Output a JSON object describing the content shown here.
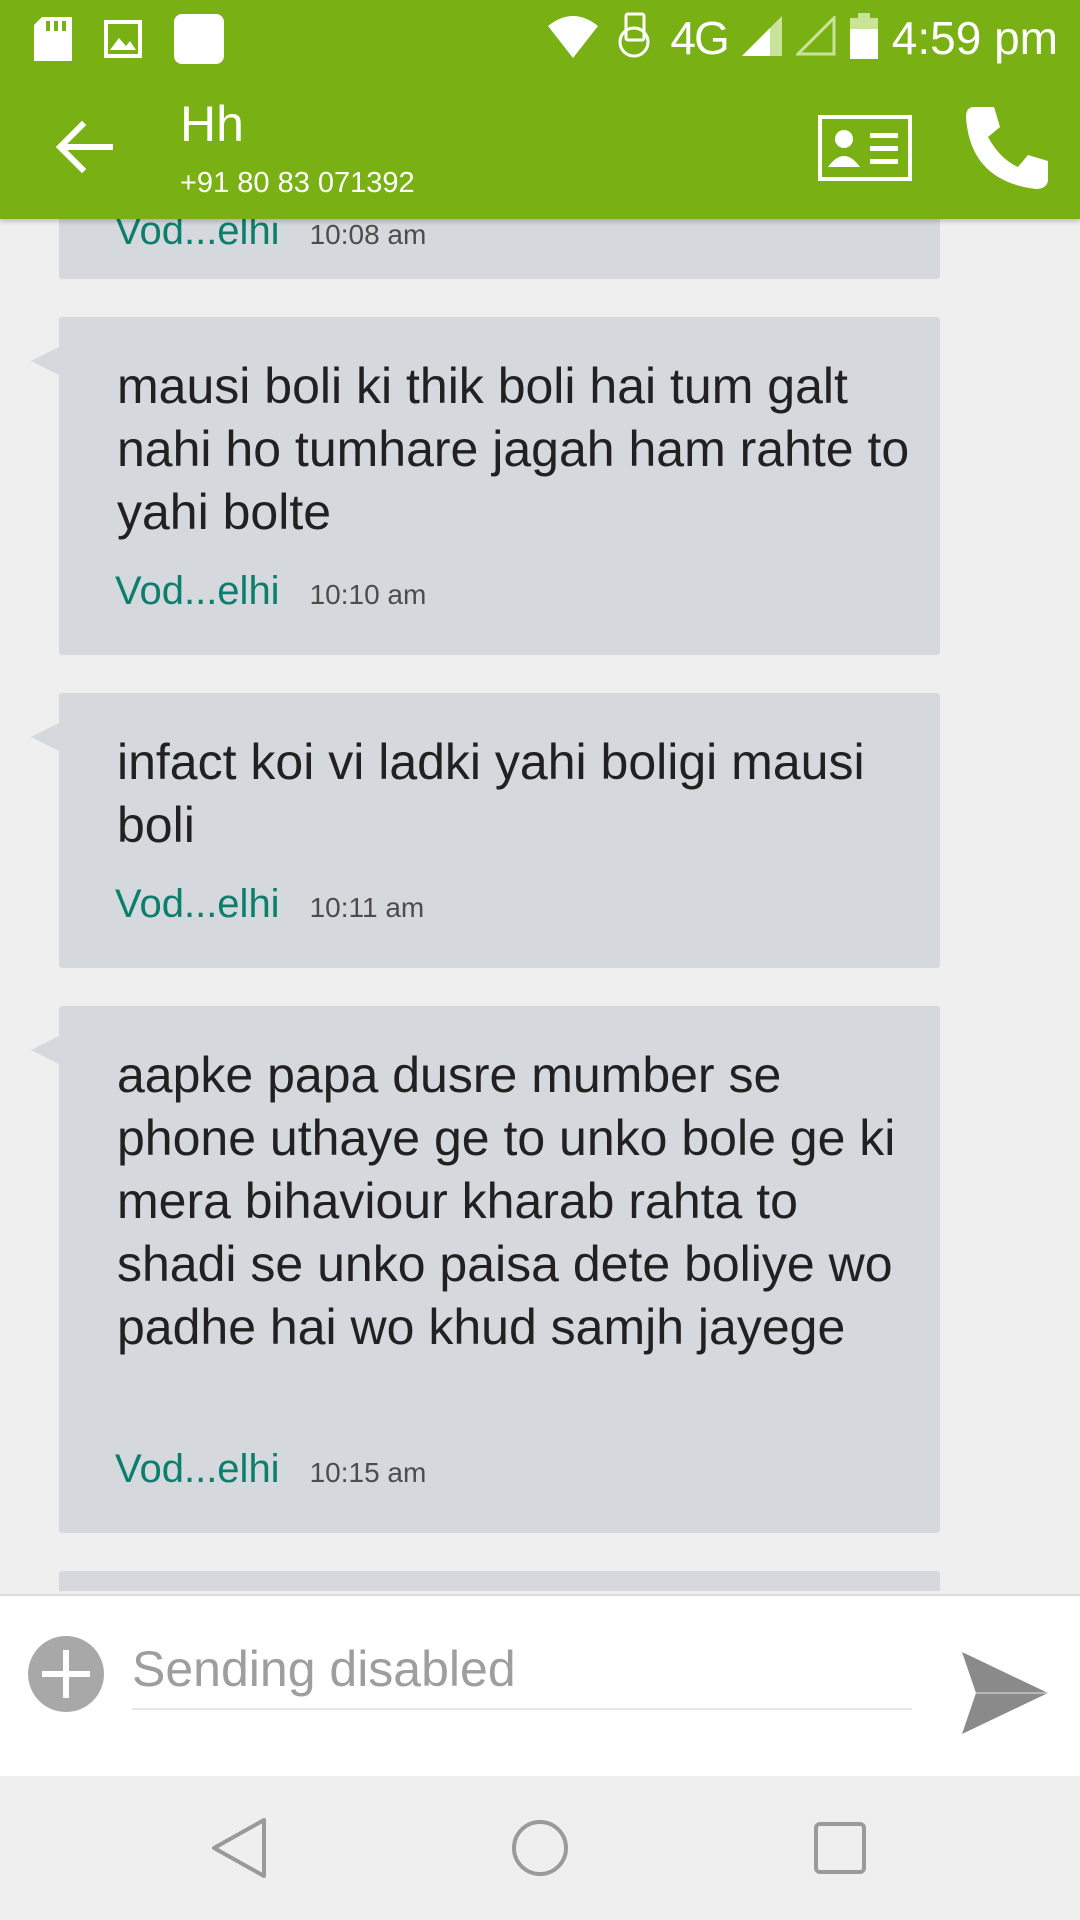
{
  "status_bar": {
    "network": "4G",
    "time": "4:59 pm"
  },
  "header": {
    "contact_name": "Hh",
    "contact_number": "+91 80 83 071392"
  },
  "messages": [
    {
      "text": "",
      "sender": "Vod...elhi",
      "time": "10:08 am"
    },
    {
      "text": "mausi boli ki thik boli hai tum galt nahi ho tumhare jagah ham rahte to yahi bolte",
      "sender": "Vod...elhi",
      "time": "10:10 am"
    },
    {
      "text": "infact koi vi ladki yahi boligi mausi boli",
      "sender": "Vod...elhi",
      "time": "10:11 am"
    },
    {
      "text": "aapke papa dusre mumber se phone uthaye ge to unko bole ge ki mera bihaviour kharab rahta to shadi se unko paisa dete boliye wo padhe hai wo khud samjh jayege",
      "sender": "Vod...elhi",
      "time": "10:15 am"
    }
  ],
  "compose": {
    "placeholder": "Sending disabled"
  },
  "colors": {
    "app_bar": "#79b115",
    "bubble": "#d5d8dc",
    "sender": "#0b7f6e"
  }
}
